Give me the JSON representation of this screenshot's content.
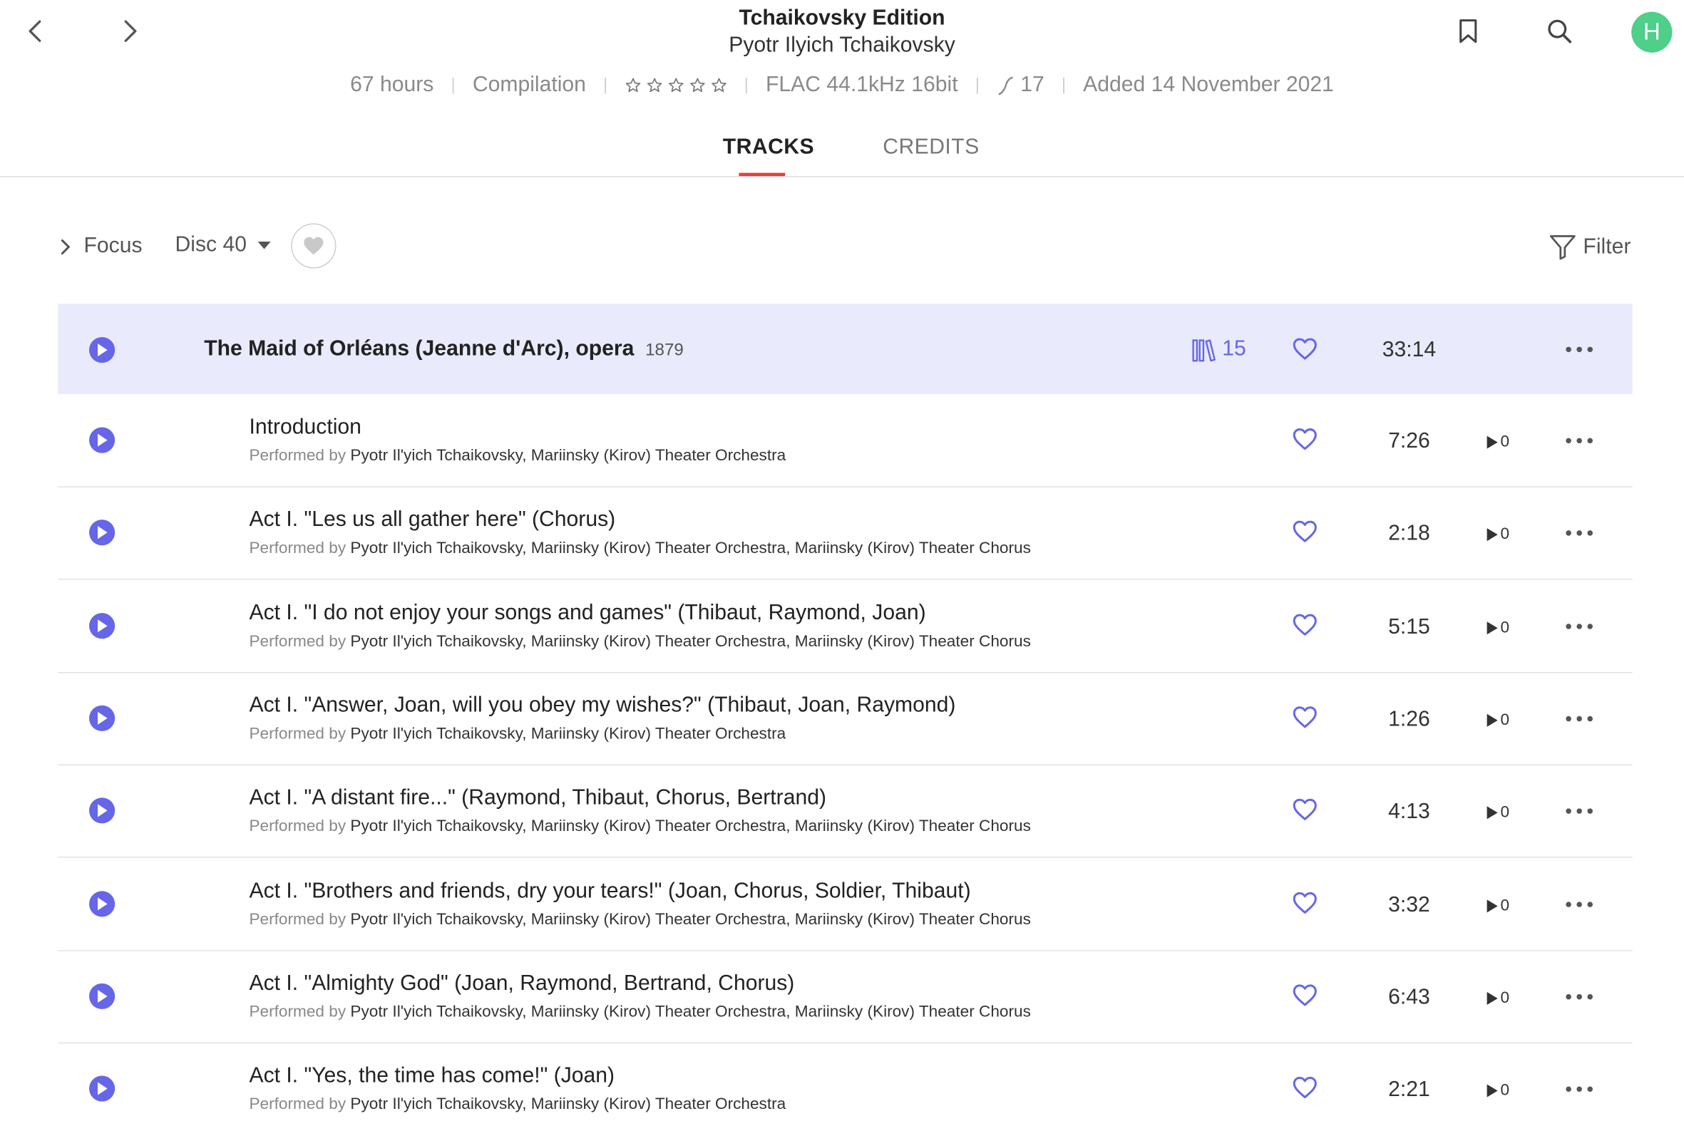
{
  "header": {
    "title": "Tchaikovsky Edition",
    "artist": "Pyotr Ilyich Tchaikovsky",
    "meta": {
      "duration": "67 hours",
      "type": "Compilation",
      "rating_stars": 5,
      "quality": "FLAC 44.1kHz 16bit",
      "versions": "17",
      "added": "Added 14 November 2021"
    },
    "avatar_letter": "H",
    "avatar_color": "#4ecf8a"
  },
  "tabs": {
    "tracks": "TRACKS",
    "credits": "CREDITS",
    "active": "TRACKS"
  },
  "toolbar": {
    "focus": "Focus",
    "disc": "Disc 40",
    "filter": "Filter"
  },
  "work": {
    "title": "The Maid of Orléans (Jeanne d'Arc), opera",
    "year": "1879",
    "count": "15",
    "duration": "33:14"
  },
  "tracks": [
    {
      "title": "Introduction",
      "performed_label": "Performed by",
      "performers": "Pyotr Il'yich Tchaikovsky, Mariinsky (Kirov) Theater Orchestra",
      "duration": "7:26",
      "plays": "0"
    },
    {
      "title": "Act I. \"Les us all gather here\" (Chorus)",
      "performed_label": "Performed by",
      "performers": "Pyotr Il'yich Tchaikovsky, Mariinsky (Kirov) Theater Orchestra, Mariinsky (Kirov) Theater Chorus",
      "duration": "2:18",
      "plays": "0"
    },
    {
      "title": "Act I. \"I do not enjoy your songs and games\" (Thibaut, Raymond, Joan)",
      "performed_label": "Performed by",
      "performers": "Pyotr Il'yich Tchaikovsky, Mariinsky (Kirov) Theater Orchestra, Mariinsky (Kirov) Theater Chorus",
      "duration": "5:15",
      "plays": "0"
    },
    {
      "title": "Act I. \"Answer, Joan, will you obey my wishes?\" (Thibaut, Joan, Raymond)",
      "performed_label": "Performed by",
      "performers": "Pyotr Il'yich Tchaikovsky, Mariinsky (Kirov) Theater Orchestra",
      "duration": "1:26",
      "plays": "0"
    },
    {
      "title": "Act I. \"A distant fire...\" (Raymond, Thibaut, Chorus, Bertrand)",
      "performed_label": "Performed by",
      "performers": "Pyotr Il'yich Tchaikovsky, Mariinsky (Kirov) Theater Orchestra, Mariinsky (Kirov) Theater Chorus",
      "duration": "4:13",
      "plays": "0"
    },
    {
      "title": "Act I. \"Brothers and friends, dry your tears!\" (Joan, Chorus, Soldier, Thibaut)",
      "performed_label": "Performed by",
      "performers": "Pyotr Il'yich Tchaikovsky, Mariinsky (Kirov) Theater Orchestra, Mariinsky (Kirov) Theater Chorus",
      "duration": "3:32",
      "plays": "0"
    },
    {
      "title": "Act I. \"Almighty God\" (Joan, Raymond, Bertrand, Chorus)",
      "performed_label": "Performed by",
      "performers": "Pyotr Il'yich Tchaikovsky, Mariinsky (Kirov) Theater Orchestra, Mariinsky (Kirov) Theater Chorus",
      "duration": "6:43",
      "plays": "0"
    },
    {
      "title": "Act I. \"Yes, the time has come!\" (Joan)",
      "performed_label": "Performed by",
      "performers": "Pyotr Il'yich Tchaikovsky, Mariinsky (Kirov) Theater Orchestra",
      "duration": "2:21",
      "plays": "0"
    }
  ],
  "colors": {
    "accent": "#6666e8",
    "tab_underline": "#e0413a",
    "work_row_bg": "#e9eafb"
  }
}
